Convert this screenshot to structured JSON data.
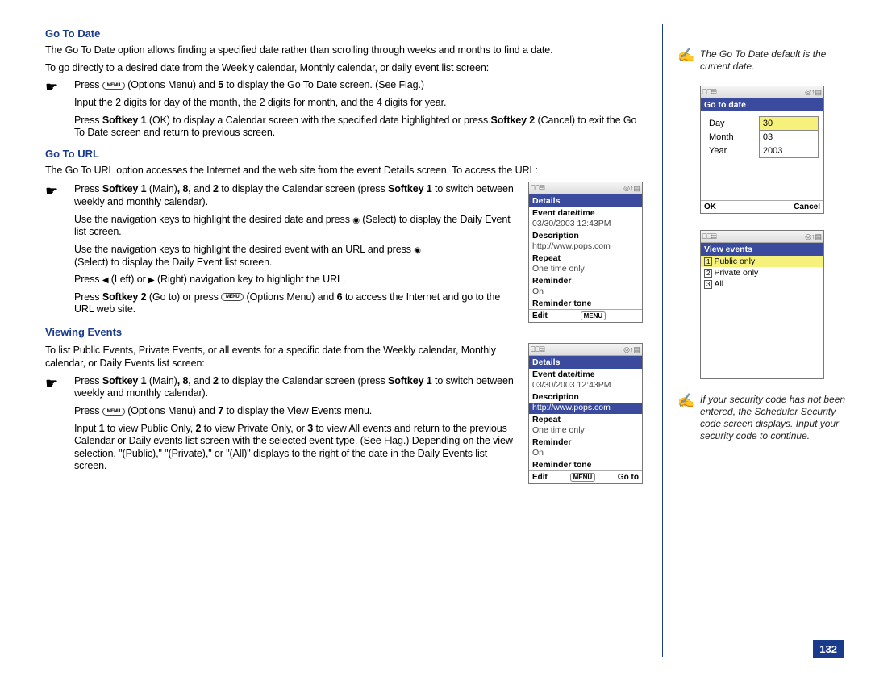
{
  "main": {
    "gotodate": {
      "heading": "Go To Date",
      "p1": "The Go To Date option allows finding a specified date rather than scrolling through weeks and months to find a date.",
      "p2": "To go directly to a desired date from the Weekly calendar, Monthly calendar, or daily event list screen:",
      "bullets": {
        "b1a": "Press ",
        "b1b": " (Options Menu) and ",
        "b1c": " to display the Go To Date screen. (See Flag.)",
        "b2": "Input the 2 digits for day of the month, the 2 digits for month, and the 4 digits for year.",
        "b3a": "Press ",
        "b3b": " (OK) to display a Calendar screen with the specified date highlighted or press ",
        "b3c": " (Cancel) to exit the Go To Date screen and return to previous screen."
      },
      "menu": "MENU",
      "five": "5",
      "sk1": "Softkey 1",
      "sk2": "Softkey 2"
    },
    "gotourl": {
      "heading": "Go To URL",
      "p1": "The Go To URL option accesses the Internet and the web site from the event Details screen. To access the URL:",
      "b1a": "Press ",
      "b1b": " (Main)",
      "b1c": " and ",
      "b1d": " to display the Calendar screen (press ",
      "b1e": " to switch between weekly and monthly calendar).",
      "sk1": "Softkey 1",
      "eight": ", 8,",
      "two": "2",
      "b2a": "Use the navigation keys to highlight the desired date and press ",
      "b2b": " (Select) to display the Daily Event list screen.",
      "b3a": "Use the navigation keys to highlight the desired event with an URL and press ",
      "b3b": " (Select) to display the Daily Event list screen.",
      "b4a": "Press ",
      "b4b": " (Left) or ",
      "b4c": " (Right) navigation key to highlight the URL.",
      "b5a": "Press ",
      "sk2": "Softkey 2",
      "b5b": " (Go to) or press ",
      "menu": "MENU",
      "b5c": " (Options Menu) and ",
      "six": "6",
      "b5d": " to access the Internet and go to the URL web site."
    },
    "viewing": {
      "heading": "Viewing Events",
      "p1": "To list Public Events, Private Events, or all events for a specific date from the Weekly calendar, Monthly calendar, or Daily Events list screen:",
      "b1a": "Press ",
      "sk1": "Softkey 1",
      "b1b": " (Main)",
      "eight": ", 8,",
      "b1c": " and ",
      "two": "2",
      "b1d": " to display the Calendar screen (press ",
      "b1e": " to switch between weekly and monthly calendar).",
      "b2a": "Press ",
      "menu": "MENU",
      "b2b": " (Options Menu) and ",
      "seven": "7",
      "b2c": " to display the View Events menu.",
      "b3a": "Input ",
      "one": "1",
      "b3b": " to view Public Only, ",
      "twob": "2",
      "b3c": " to view Private Only, or ",
      "three": "3",
      "b3d": " to view All events and return to the previous Calendar or Daily events list screen with the selected event type. (See Flag.) Depending on the view selection, \"(Public),\" \"(Private),\" or \"(All)\" displays to the right of the date in the Daily Events list screen."
    },
    "details_phone": {
      "title": "Details",
      "r1": "Event date/time",
      "r1v": "03/30/2003 12:43PM",
      "r2": "Description",
      "r2v": "http://www.pops.com",
      "r3": "Repeat",
      "r3v": "One time only",
      "r4": "Reminder",
      "r4v": "On",
      "r5": "Reminder tone",
      "foot_left": "Edit",
      "foot_mid": "MENU",
      "foot_right": "Go to"
    }
  },
  "side": {
    "note1": "The Go To Date default is the current date.",
    "gtd_phone": {
      "title": "Go to date",
      "day": "Day",
      "dayv": "30",
      "month": "Month",
      "monthv": "03",
      "year": "Year",
      "yearv": "2003",
      "ok": "OK",
      "cancel": "Cancel"
    },
    "view_phone": {
      "title": "View events",
      "i1": "Public only",
      "i2": "Private only",
      "i3": "All"
    },
    "note2": "If your security code has not been entered, the Scheduler Security code screen displays. Input your security code to continue."
  },
  "page_num": "132"
}
